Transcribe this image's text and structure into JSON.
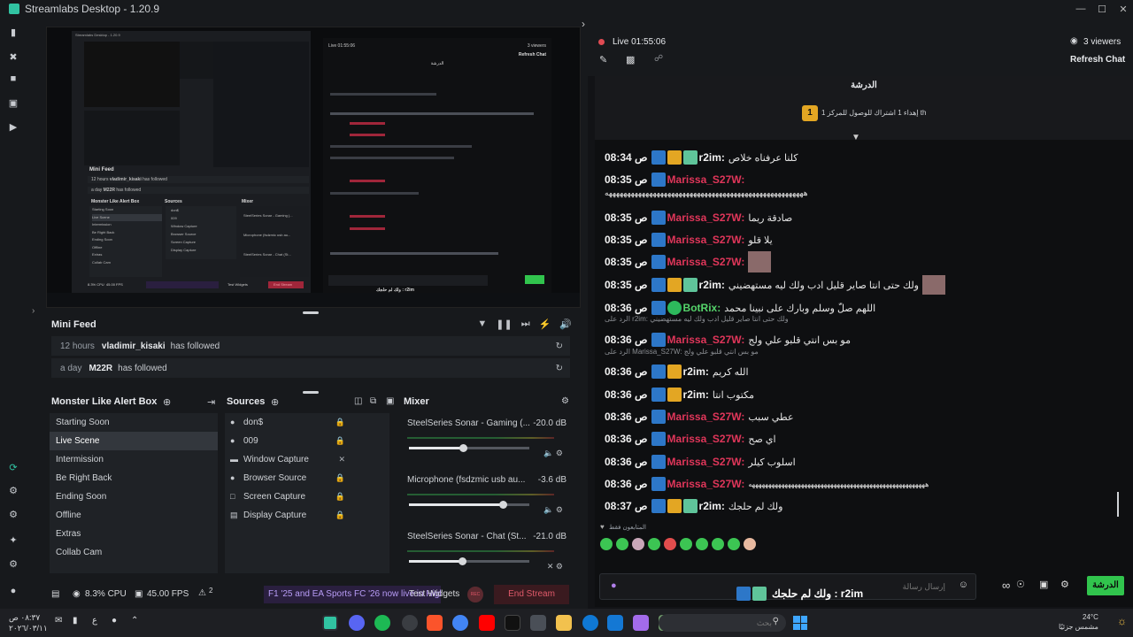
{
  "app": {
    "title": "Streamlabs Desktop - 1.20.9"
  },
  "preview": {
    "inner_title": "Streamlabs Desktop - 1.20.9",
    "inner_minifeed": "Mini Feed",
    "inner_feed_1_time": "12 hours",
    "inner_feed_1_user": "vladimir_kisaki",
    "inner_feed_1_action": "has followed",
    "inner_feed_2_time": "a day",
    "inner_feed_2_user": "M22R",
    "inner_feed_2_action": "has followed",
    "inner_scenes_title": "Monster Like Alert Box",
    "inner_sources_title": "Sources",
    "inner_mixer_title": "Mixer",
    "inner_scenes": [
      "Starting Soon",
      "Live Scene",
      "Intermission",
      "Be Right Back",
      "Ending Soon",
      "Offline",
      "Extras",
      "Collab Cam"
    ],
    "inner_sources": [
      "don$",
      "009",
      "Window Capture",
      "Browser Source",
      "Screen Capture",
      "Display Capture"
    ],
    "inner_mixer": [
      "SteelSeries Sonar - Gaming (...",
      "Microphone (fsdzmic usb au...",
      "SteelSeries Sonar - Chat (St..."
    ],
    "inner_cpu": "8.3% CPU",
    "inner_fps": "45.00 FPS",
    "inner_test": "Test Widgets",
    "inner_end": "End Stream",
    "inner_chat_header": "الدرشة",
    "inner_time": "Live 01:55:06",
    "inner_viewers": "3 viewers",
    "inner_refresh": "Refresh Chat",
    "inner_chat_bottom": "ولك لم حلجك : r2im"
  },
  "minifeed": {
    "title": "Mini Feed",
    "items": [
      {
        "time": "12 hours",
        "user": "vladimir_kisaki",
        "action": "has followed"
      },
      {
        "time": "a day",
        "user": "M22R",
        "action": "has followed"
      }
    ]
  },
  "scenes": {
    "title": "Monster Like Alert Box",
    "items": [
      "Starting Soon",
      "Live Scene",
      "Intermission",
      "Be Right Back",
      "Ending Soon",
      "Offline",
      "Extras",
      "Collab Cam"
    ],
    "active": "Live Scene"
  },
  "sources": {
    "title": "Sources",
    "items": [
      "don$",
      "009",
      "Window Capture",
      "Browser Source",
      "Screen Capture",
      "Display Capture"
    ]
  },
  "mixer": {
    "title": "Mixer",
    "channels": [
      {
        "name": "SteelSeries Sonar - Gaming (...",
        "db": "-20.0 dB",
        "level": 0.45
      },
      {
        "name": "Microphone (fsdzmic usb au...",
        "db": "-3.6 dB",
        "level": 0.78
      },
      {
        "name": "SteelSeries Sonar - Chat (St...",
        "db": "-21.0 dB",
        "level": 0.44
      }
    ]
  },
  "statusbar": {
    "cpu": "8.3% CPU",
    "fps": "45.00 FPS",
    "alerts": "2",
    "ticker": "F1 '25 and EA Sports FC '26 now live in Highlight",
    "test_widgets": "Test Widgets",
    "rec": "REC",
    "end_stream": "End Stream"
  },
  "chat": {
    "live_time": "Live 01:55:06",
    "viewers": "3 viewers",
    "refresh": "Refresh Chat",
    "header": "الدرشة",
    "pinned": "إهداء 1 اشتراك للوصول للمركز 1 th",
    "pinned_rank": "1",
    "messages": [
      {
        "time": "08:34 ص",
        "user": "r2im:",
        "text": "كلنا عرفناه خلاص",
        "color": "white"
      },
      {
        "time": "08:35 ص",
        "user": "Marissa_S27W:",
        "text": "",
        "color": "pink"
      },
      {
        "time": "08:35 ص",
        "user": "Marissa_S27W:",
        "text": "صادقة ريما",
        "color": "pink"
      },
      {
        "time": "08:35 ص",
        "user": "Marissa_S27W:",
        "text": "يلا قلو",
        "color": "pink"
      },
      {
        "time": "08:35 ص",
        "user": "Marissa_S27W:",
        "text": "",
        "color": "pink"
      },
      {
        "time": "08:35 ص",
        "user": "r2im:",
        "text": "ولك حتى انتا صاير قليل ادب ولك ليه مستهضيني",
        "color": "white"
      },
      {
        "time": "08:36 ص",
        "user": "BotRix:",
        "text": "اللهم صلّ وسلم وبارك على نبينا محمد",
        "color": "green"
      },
      {
        "time": "08:36 ص",
        "user": "Marissa_S27W:",
        "text": "مو بس انتي قلبو علي ولج",
        "color": "pink"
      },
      {
        "time": "08:36 ص",
        "user": "r2im:",
        "text": "الله كريم",
        "color": "white"
      },
      {
        "time": "08:36 ص",
        "user": "r2im:",
        "text": "مكتوب انتا",
        "color": "white"
      },
      {
        "time": "08:36 ص",
        "user": "Marissa_S27W:",
        "text": "عطي سبب",
        "color": "pink"
      },
      {
        "time": "08:36 ص",
        "user": "Marissa_S27W:",
        "text": "اي صح",
        "color": "pink"
      },
      {
        "time": "08:36 ص",
        "user": "Marissa_S27W:",
        "text": "اسلوب كيلر",
        "color": "pink"
      },
      {
        "time": "08:36 ص",
        "user": "Marissa_S27W:",
        "text": "",
        "color": "pink"
      },
      {
        "time": "08:37 ص",
        "user": "r2im:",
        "text": "ولك لم حلجك",
        "color": "white"
      }
    ],
    "long_text": "ههههههههههههههههههههههههههههههههههههههههههههههههههههههه",
    "reply1": "الرد على r2im: ولك حتى انتا صاير قليل ادب ولك ليه مستهضيني",
    "reply2": "الرد على Marissa_S27W: مو بس انتي قلبو علي ولج",
    "followers_only": "المتابعون فقط",
    "input_placeholder": "إرسال رسالة",
    "send": "الدرشة",
    "bottom_banner": "ولك لم حلجك : r2im"
  },
  "taskbar": {
    "time": "٠٨:٣٧ ص",
    "date": "٢٠٢٦/٠٣/١١",
    "lang": "ع",
    "search_placeholder": "بحث",
    "weather_temp": "24°C",
    "weather_desc": "مشمس جزئيًا"
  },
  "colors": {
    "accent": "#31c3a2",
    "live": "#e04b53",
    "send": "#31c44d",
    "pink_user": "#e0365a"
  }
}
